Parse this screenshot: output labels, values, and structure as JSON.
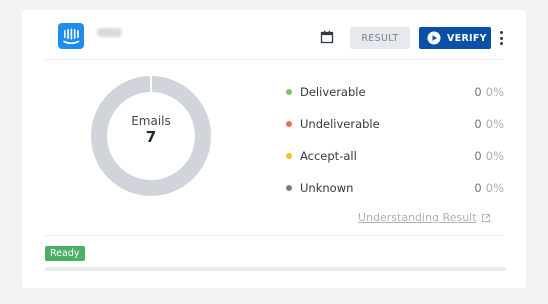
{
  "header": {
    "list_name": "",
    "logo_icon": "intercom-logo-icon",
    "calendar_icon": "calendar-icon",
    "result_label": "RESULT",
    "verify_label": "VERIFY",
    "verify_icon": "play-circle-icon",
    "menu_icon": "more-vertical-icon"
  },
  "summary": {
    "label": "Emails",
    "total": "7",
    "donut_color": "#cfd5db"
  },
  "legend": [
    {
      "label": "Deliverable",
      "count": "0",
      "percent": "0%",
      "color": "#7dc462"
    },
    {
      "label": "Undeliverable",
      "count": "0",
      "percent": "0%",
      "color": "#f36c4f"
    },
    {
      "label": "Accept-all",
      "count": "0",
      "percent": "0%",
      "color": "#f5c02c"
    },
    {
      "label": "Unknown",
      "count": "0",
      "percent": "0%",
      "color": "#6d7f8c"
    }
  ],
  "understanding_link": "Understanding Result",
  "status": {
    "badge": "Ready",
    "badge_color": "#4caf64",
    "progress": 0
  }
}
